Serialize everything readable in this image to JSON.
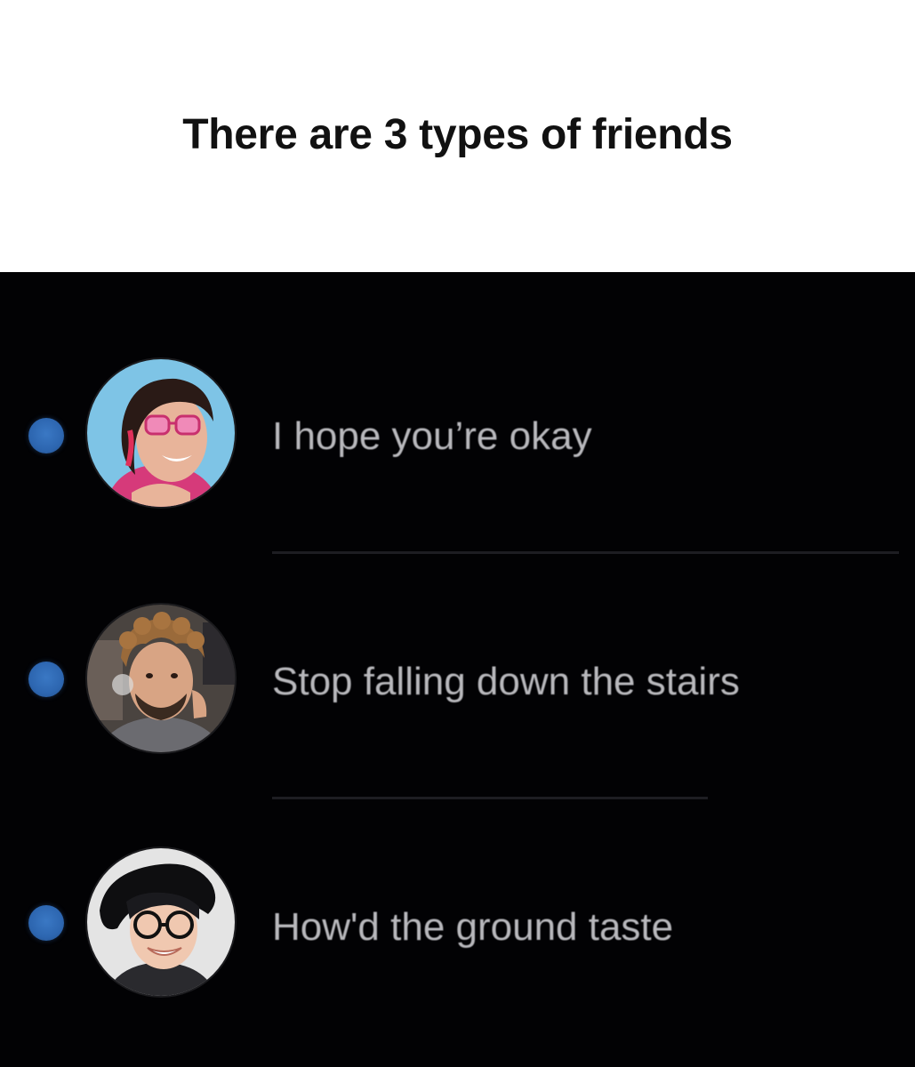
{
  "caption": {
    "title": "There are 3 types of friends"
  },
  "conversations": [
    {
      "message": "I hope you’re okay",
      "unread": true,
      "avatar_icon": "person-pink-sunglasses-avatar"
    },
    {
      "message": "Stop falling down the stairs",
      "unread": true,
      "avatar_icon": "person-curly-hair-avatar"
    },
    {
      "message": "How'd the ground taste",
      "unread": true,
      "avatar_icon": "person-black-hat-glasses-avatar"
    }
  ],
  "colors": {
    "unread_dot": "#2d66b0",
    "background": "#020204",
    "message_text": "#b8b8bc",
    "caption_bg": "#ffffff"
  }
}
